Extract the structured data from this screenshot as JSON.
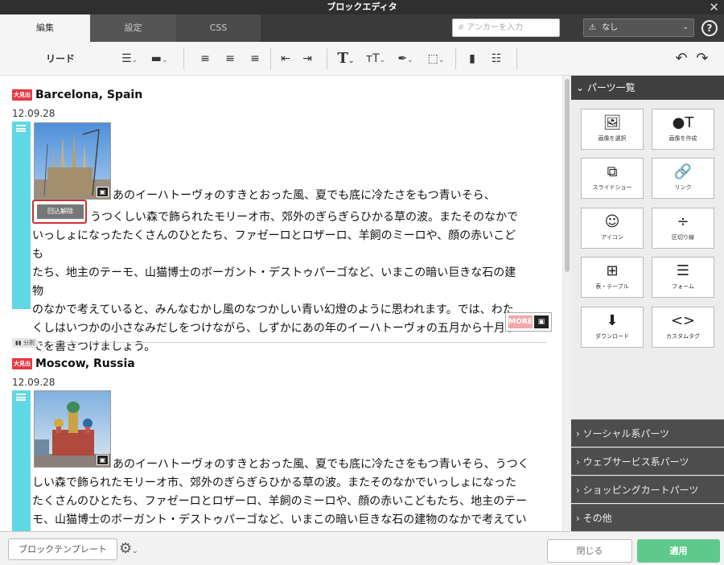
{
  "window": {
    "title": "ブロックエディタ",
    "close_glyph": "✕"
  },
  "tabs": [
    {
      "label": "編集"
    },
    {
      "label": "設定"
    },
    {
      "label": "CSS"
    }
  ],
  "anchor": {
    "placeholder": "アンカーを入力",
    "select_value": "なし",
    "help_glyph": "?"
  },
  "toolbar": {
    "paragraph_style": "リード"
  },
  "articles": [
    {
      "badge": "大見出",
      "title": "Barcelona, Spain",
      "date": "12.09.28",
      "text_line1": "あのイーハトーヴォのすきとおった風、夏でも底に冷たさをもつ青いそら、",
      "text_rest": "うつくしい森で飾られたモリーオ市、郊外のぎらぎらひかる草の波。またそのなかで\nいっしょになったたくさんのひとたち、ファゼーロとロザーロ、羊飼のミーロや、顔の赤いこども\nたち、地主のテーモ、山猫博士のボーガント・デストゥパーゴなど、いまこの暗い巨きな石の建物\nのなかで考えていると、みんなむかし風のなつかしい青い幻燈のように思われます。では、わた\nくしはいつかの小さなみだしをつけながら、しずかにあの年のイーハトーヴォの五月から十月ま\nでを書きつけましょう。",
      "wrap_label": "回込解除",
      "more_label": "MORE"
    },
    {
      "badge": "大見出",
      "title": "Moscow, Russia",
      "date": "12.09.28",
      "text_line1": "あのイーハトーヴォのすきとおった風、夏でも底に冷たさをもつ青いそら、うつく",
      "text_rest": "しい森で飾られたモリーオ市、郊外のぎらぎらひかる草の波。またそのなかでいっしょになった\nたくさんのひとたち、ファゼーロとロザーロ、羊飼のミーロや、顔の赤いこどもたち、地主のテー\nモ、山猫博士のボーガント・デストゥパーゴなど、いまこの暗い巨きな石の建物のなかで考えてい\nると、みんなむかし風のなつかしい青い幻燈のように思われます。では、わたくしはいつかの小"
    }
  ],
  "divider": {
    "label": "分割"
  },
  "panel": {
    "title": "パーツ一覧",
    "parts": [
      {
        "label": "画像を選択",
        "icon": "image-icon"
      },
      {
        "label": "画像を作成",
        "icon": "shapes-icon"
      },
      {
        "label": "スライドショー",
        "icon": "slideshow-icon"
      },
      {
        "label": "リンク",
        "icon": "link-icon"
      },
      {
        "label": "アイコン",
        "icon": "smiley-icon"
      },
      {
        "label": "区切り線",
        "icon": "divider-icon"
      },
      {
        "label": "表・テーブル",
        "icon": "table-icon"
      },
      {
        "label": "フォーム",
        "icon": "form-icon"
      },
      {
        "label": "ダウンロード",
        "icon": "download-icon"
      },
      {
        "label": "カスタムタグ",
        "icon": "code-icon"
      }
    ],
    "sections": [
      {
        "label": "ソーシャル系パーツ"
      },
      {
        "label": "ウェブサービス系パーツ"
      },
      {
        "label": "ショッピングカートパーツ"
      },
      {
        "label": "その他"
      }
    ]
  },
  "footer": {
    "template_button": "ブロックテンプレート",
    "close_button": "閉じる",
    "apply_button": "適用"
  },
  "colors": {
    "accent_cyan": "#5fd7e5",
    "apply_green": "#5ec98b",
    "badge_red": "#e53946",
    "dark_bar": "#3a3a3a"
  }
}
